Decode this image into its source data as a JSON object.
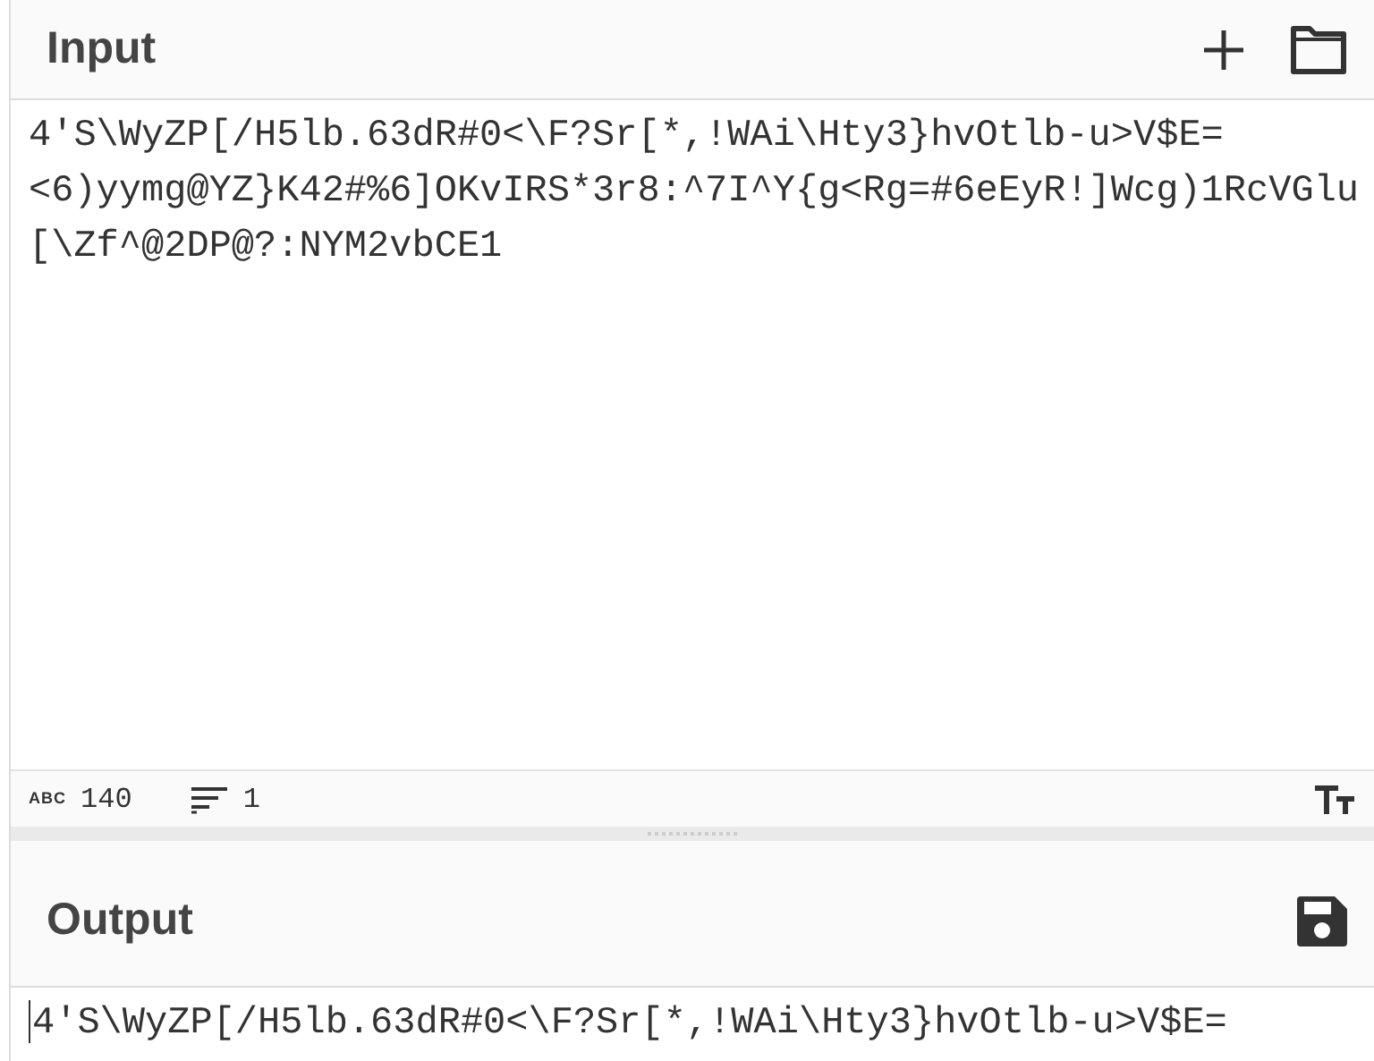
{
  "input": {
    "title": "Input",
    "lines": [
      "4'S\\WyZP[/H5lb.63dR#0<\\F?Sr[*,!WAi\\Hty3}hvOtlb-u>V$E=",
      "<6)yymg@YZ}K42#%6]OKvIRS*3r8:^7I^Y{g<Rg=#6eEyR!]Wcg)1RcVGlu",
      "[\\Zf^@2DP@?:NYM2vbCE1"
    ]
  },
  "status_bar": {
    "chars_label": "ABC",
    "chars": "140",
    "lines": "1"
  },
  "output": {
    "title": "Output",
    "lines": [
      "4'S\\WyZP[/H5lb.63dR#0<\\F?Sr[*,!WAi\\Hty3}hvOtlb-u>V$E="
    ]
  }
}
